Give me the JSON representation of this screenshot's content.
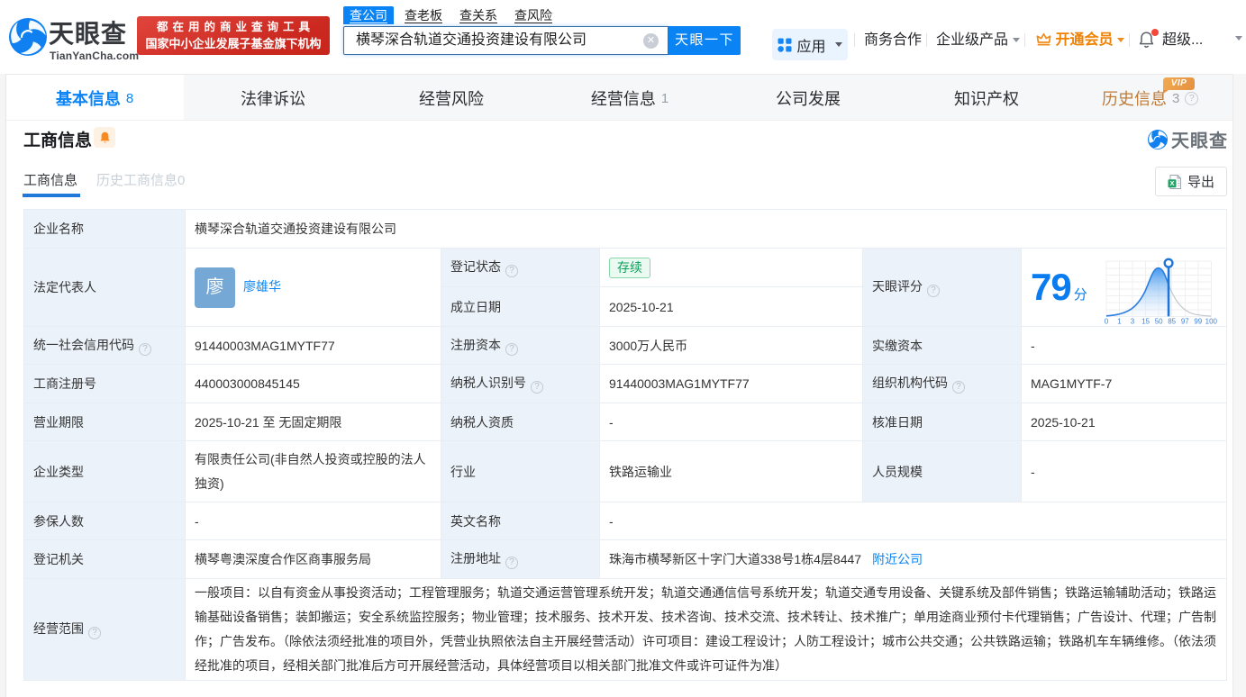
{
  "colors": {
    "accent": "#0a84f4",
    "vip_orange": "#f08000",
    "status_green": "#11a05c",
    "slogan_red": "#cb2920"
  },
  "brand": {
    "logo_cn": "天眼查",
    "logo_en": "TianYanCha.com",
    "slogan_line1": "都在用的商业查询工具",
    "slogan_line2": "国家中小企业发展子基金旗下机构"
  },
  "search": {
    "tabs": [
      "查公司",
      "查老板",
      "查关系",
      "查风险"
    ],
    "active_tab": "查公司",
    "value": "横琴深合轨道交通投资建设有限公司",
    "button": "天眼一下"
  },
  "topnav": {
    "apps": "应用",
    "cooperation": "商务合作",
    "enterprise": "企业级产品",
    "vip": "开通会员",
    "super": "超级..."
  },
  "page_tabs": [
    {
      "label": "基本信息",
      "count": "8",
      "active": true
    },
    {
      "label": "法律诉讼",
      "count": ""
    },
    {
      "label": "经营风险",
      "count": ""
    },
    {
      "label": "经营信息",
      "count": "1"
    },
    {
      "label": "公司发展",
      "count": ""
    },
    {
      "label": "知识产权",
      "count": ""
    },
    {
      "label": "历史信息",
      "count": "3",
      "vip_badge": "VIP"
    }
  ],
  "section": {
    "title": "工商信息",
    "watermark": "天眼查",
    "subtab_active": "工商信息",
    "subtab_history": "历史工商信息0",
    "export": "导出"
  },
  "table": {
    "company_name_label": "企业名称",
    "company_name": "横琴深合轨道交通投资建设有限公司",
    "legal_rep_label": "法定代表人",
    "legal_rep_avatar": "廖",
    "legal_rep_name": "廖雄华",
    "reg_status_label": "登记状态",
    "reg_status": "存续",
    "establish_date_label": "成立日期",
    "establish_date": "2025-10-21",
    "score_label": "天眼评分",
    "score_value": "79",
    "score_unit": "分",
    "uscc_label": "统一社会信用代码",
    "uscc": "91440003MAG1MYTF77",
    "reg_capital_label": "注册资本",
    "reg_capital": "3000万人民币",
    "paid_capital_label": "实缴资本",
    "paid_capital": "-",
    "reg_number_label": "工商注册号",
    "reg_number": "440003000845145",
    "taxpayer_id_label": "纳税人识别号",
    "taxpayer_id": "91440003MAG1MYTF77",
    "org_code_label": "组织机构代码",
    "org_code": "MAG1MYTF-7",
    "business_term_label": "营业期限",
    "business_term": "2025-10-21 至 无固定期限",
    "taxpayer_quality_label": "纳税人资质",
    "taxpayer_quality": "-",
    "approval_date_label": "核准日期",
    "approval_date": "2025-10-21",
    "company_type_label": "企业类型",
    "company_type": "有限责任公司(非自然人投资或控股的法人独资)",
    "industry_label": "行业",
    "industry": "铁路运输业",
    "staff_size_label": "人员规模",
    "staff_size": "-",
    "insured_label": "参保人数",
    "insured": "-",
    "english_name_label": "英文名称",
    "english_name": "-",
    "reg_authority_label": "登记机关",
    "reg_authority": "横琴粤澳深度合作区商事服务局",
    "reg_address_label": "注册地址",
    "reg_address": "珠海市横琴新区十字门大道338号1栋4层8447",
    "nearby_link": "附近公司",
    "business_scope_label": "经营范围",
    "business_scope": "一般项目：以自有资金从事投资活动；工程管理服务；轨道交通运营管理系统开发；轨道交通通信信号系统开发；轨道交通专用设备、关键系统及部件销售；铁路运输辅助活动；铁路运输基础设备销售；装卸搬运；安全系统监控服务；物业管理；技术服务、技术开发、技术咨询、技术交流、技术转让、技术推广；单用途商业预付卡代理销售；广告设计、代理；广告制作；广告发布。（除依法须经批准的项目外，凭营业执照依法自主开展经营活动）许可项目：建设工程设计；人防工程设计；城市公共交通；公共铁路运输；铁路机车车辆维修。（依法须经批准的项目，经相关部门批准后方可开展经营活动，具体经营项目以相关部门批准文件或许可证件为准）"
  },
  "score_chart": {
    "type": "area",
    "score": 79,
    "x_labels": [
      "0",
      "1",
      "3",
      "15",
      "50",
      "85",
      "97",
      "99",
      "100"
    ],
    "marker_fraction": 0.59,
    "peak_fraction": 0.49
  }
}
